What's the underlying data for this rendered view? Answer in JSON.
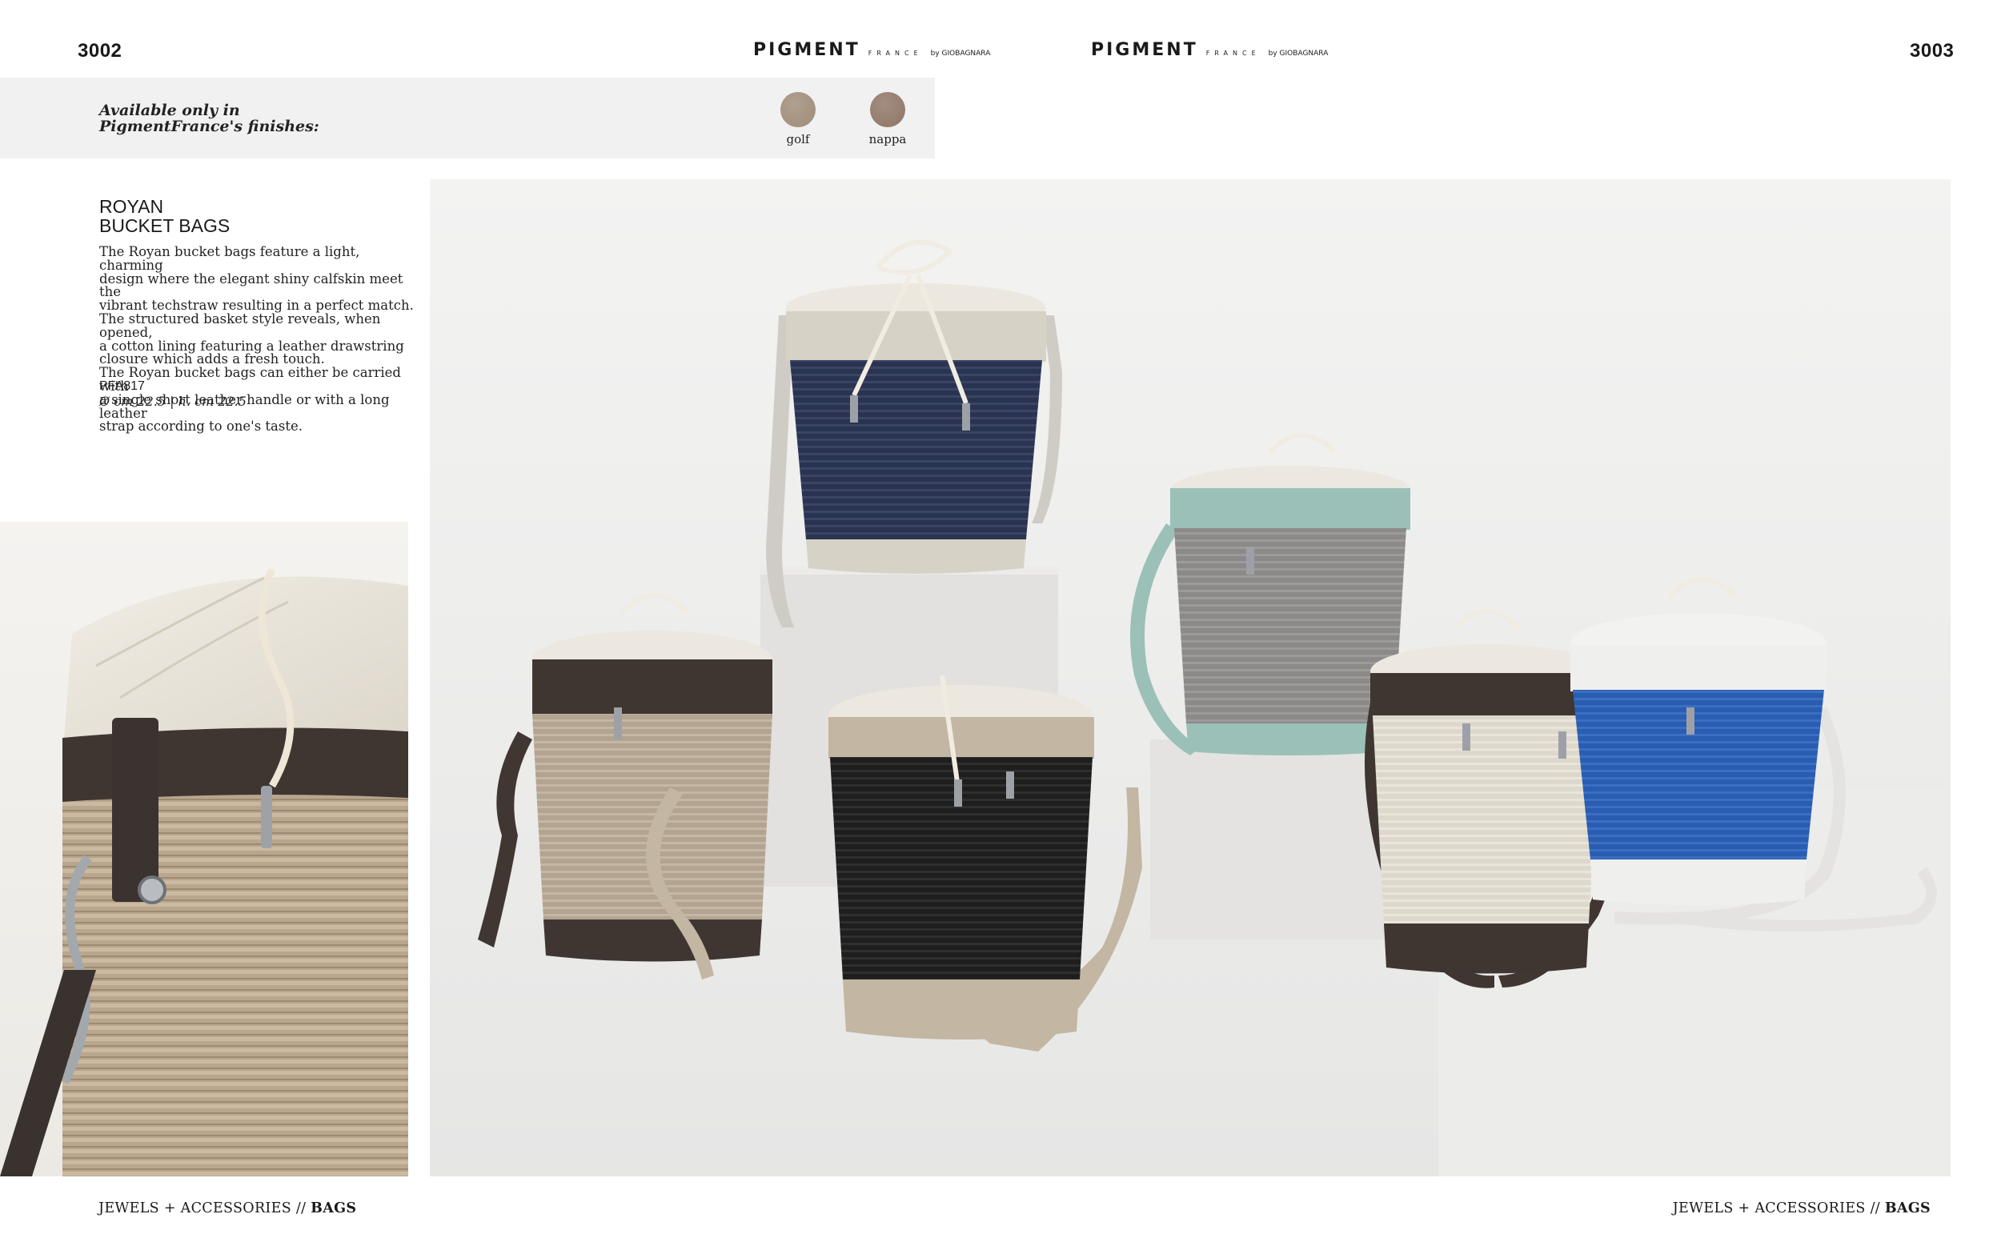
{
  "header": {
    "page_left": "3002",
    "page_right": "3003",
    "brand_main": "PIGMENT",
    "brand_sub": "FRANCE",
    "brand_by": "by GIOBAGNARA"
  },
  "finishes": {
    "label_line1": "Available only in",
    "label_line2": "PigmentFrance's finishes:",
    "items": [
      {
        "name": "golf",
        "color": "#a08c78"
      },
      {
        "name": "nappa",
        "color": "#8f7565"
      }
    ]
  },
  "product": {
    "title_line1": "ROYAN",
    "title_line2": "BUCKET BAGS",
    "description": [
      "The Royan bucket bags feature a light, charming",
      "design where the elegant shiny calfskin meet the",
      "vibrant techstraw resulting in a perfect match.",
      "The structured basket style reveals, when opened,",
      "a cotton lining featuring a leather drawstring",
      "closure which adds a fresh touch.",
      "The Royan bucket bags can either be carried with",
      "a single short leather handle or with a long leather",
      "strap according to one's taste."
    ],
    "code": "PFA817",
    "dimensions": "Ø cm 22.5 | h. cm 22.5"
  },
  "footer": {
    "left_prefix": "JEWELS + ACCESSORIES // ",
    "left_bold": "BAGS",
    "right_prefix": "JEWELS + ACCESSORIES // ",
    "right_bold": "BAGS"
  },
  "bag_colors": {
    "navy": "#2a3350",
    "sand": "#b3a491",
    "black": "#1e1e1e",
    "grey": "#8c8a88",
    "ivory": "#ddd8cb",
    "blue": "#2a5db0",
    "dark_brown": "#3f3632",
    "taupe": "#c3b6a2",
    "mint": "#9bc0b8",
    "white": "#efefed",
    "canvas": "#ece8df"
  }
}
